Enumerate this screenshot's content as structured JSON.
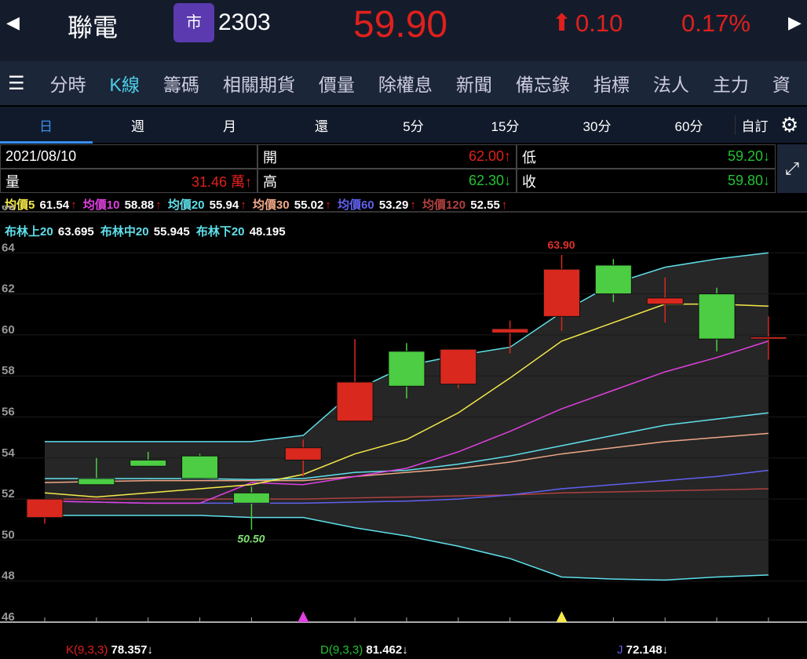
{
  "header": {
    "prev": "◀",
    "next": "▶",
    "name": "聯電",
    "market_badge": "市",
    "code": "2303",
    "price": "59.90",
    "change_arrow": "⬆",
    "change": "0.10",
    "change_pct": "0.17%"
  },
  "tabs": [
    "分時",
    "K線",
    "籌碼",
    "相關期貨",
    "價量",
    "除權息",
    "新聞",
    "備忘錄",
    "指標",
    "法人",
    "主力",
    "資"
  ],
  "periods": [
    "日",
    "週",
    "月",
    "還",
    "5分",
    "15分",
    "30分",
    "60分"
  ],
  "custom": "自訂",
  "info": {
    "date": "2021/08/10",
    "vol_label": "量",
    "vol": "31.46 萬↑",
    "open_label": "開",
    "open": "62.00↑",
    "high_label": "高",
    "high": "62.30↓",
    "low_label": "低",
    "low": "59.20↓",
    "close_label": "收",
    "close": "59.80↓"
  },
  "ma_legend": [
    {
      "label": "均價5",
      "value": "61.54",
      "arrow": "↑",
      "color": "#f5e94a"
    },
    {
      "label": "均價10",
      "value": "58.88",
      "arrow": "↑",
      "color": "#e040e0"
    },
    {
      "label": "均價20",
      "value": "55.94",
      "arrow": "↑",
      "color": "#5fe0ea"
    },
    {
      "label": "均價30",
      "value": "55.02",
      "arrow": "↑",
      "color": "#f0a888"
    },
    {
      "label": "均價60",
      "value": "53.29",
      "arrow": "↑",
      "color": "#6060f0"
    },
    {
      "label": "均價120",
      "value": "52.55",
      "arrow": "↑",
      "color": "#b04040"
    }
  ],
  "boll_legend": [
    {
      "label": "布林上20",
      "value": "63.695"
    },
    {
      "label": "布林中20",
      "value": "55.945"
    },
    {
      "label": "布林下20",
      "value": "48.195"
    }
  ],
  "kdj": {
    "k_label": "K(9,3,3)",
    "k": "78.357↓",
    "d_label": "D(9,3,3)",
    "d": "81.462↓",
    "j_label": "J",
    "j": "72.148↓"
  },
  "chart_data": {
    "type": "candlestick",
    "y_ticks": [
      "66",
      "64",
      "62",
      "60",
      "58",
      "56",
      "54",
      "52",
      "50",
      "48",
      "46"
    ],
    "ylim": [
      46,
      66
    ],
    "candles": [
      {
        "o": 51.1,
        "c": 52.0,
        "h": 52.0,
        "l": 50.8
      },
      {
        "o": 53.0,
        "c": 52.7,
        "h": 54.0,
        "l": 52.7
      },
      {
        "o": 53.9,
        "c": 53.6,
        "h": 54.3,
        "l": 53.6
      },
      {
        "o": 54.1,
        "c": 53.0,
        "h": 54.2,
        "l": 53.0
      },
      {
        "o": 52.3,
        "c": 51.8,
        "h": 52.6,
        "l": 50.5
      },
      {
        "o": 53.9,
        "c": 54.5,
        "h": 54.9,
        "l": 53.1
      },
      {
        "o": 55.8,
        "c": 57.7,
        "h": 59.8,
        "l": 55.8
      },
      {
        "o": 59.2,
        "c": 57.5,
        "h": 59.6,
        "l": 56.9
      },
      {
        "o": 57.6,
        "c": 59.3,
        "h": 59.3,
        "l": 57.4
      },
      {
        "o": 60.1,
        "c": 60.3,
        "h": 60.7,
        "l": 59.1
      },
      {
        "o": 60.9,
        "c": 63.2,
        "h": 63.9,
        "l": 60.2
      },
      {
        "o": 63.4,
        "c": 62.0,
        "h": 63.7,
        "l": 61.6
      },
      {
        "o": 61.5,
        "c": 61.8,
        "h": 62.8,
        "l": 60.6
      },
      {
        "o": 62.0,
        "c": 59.8,
        "h": 62.3,
        "l": 59.2
      },
      {
        "o": 59.8,
        "c": 59.9,
        "h": 60.9,
        "l": 58.8
      }
    ],
    "lines": {
      "ma5": [
        52.3,
        52.1,
        52.3,
        52.5,
        52.7,
        53.2,
        54.2,
        54.9,
        56.2,
        57.9,
        59.7,
        60.6,
        61.5,
        61.5,
        61.4
      ],
      "ma10": [
        51.9,
        51.85,
        51.8,
        51.8,
        52.8,
        52.7,
        53.1,
        53.5,
        54.3,
        55.3,
        56.4,
        57.3,
        58.2,
        58.9,
        59.7
      ],
      "ma20": [
        53.0,
        53.0,
        53.0,
        53.0,
        52.95,
        53.0,
        53.3,
        53.4,
        53.7,
        54.1,
        54.6,
        55.1,
        55.6,
        55.9,
        56.2
      ],
      "ma30": [
        52.8,
        52.85,
        52.9,
        52.9,
        52.9,
        52.9,
        53.1,
        53.3,
        53.5,
        53.8,
        54.2,
        54.5,
        54.8,
        55.0,
        55.2
      ],
      "ma60": [
        51.9,
        51.85,
        51.8,
        51.8,
        51.8,
        51.8,
        51.85,
        51.9,
        52.0,
        52.2,
        52.5,
        52.7,
        52.9,
        53.1,
        53.4
      ],
      "ma120": [
        52.0,
        52.0,
        52.0,
        52.0,
        52.0,
        52.0,
        52.05,
        52.1,
        52.15,
        52.2,
        52.3,
        52.35,
        52.4,
        52.45,
        52.5
      ],
      "boll_up": [
        54.8,
        54.8,
        54.8,
        54.8,
        54.8,
        55.1,
        57.3,
        58.5,
        59.0,
        59.4,
        61.1,
        62.5,
        63.3,
        63.7,
        64.0
      ],
      "boll_low": [
        51.2,
        51.2,
        51.2,
        51.2,
        51.1,
        51.1,
        50.6,
        50.2,
        49.7,
        49.1,
        48.2,
        48.1,
        48.05,
        48.2,
        48.3
      ]
    },
    "annotations": [
      {
        "text": "63.90",
        "candle": 10,
        "value": 63.9
      },
      {
        "text": "50.50",
        "candle": 4,
        "value": 50.5
      }
    ],
    "signals": [
      {
        "candle": 5,
        "color": "#e040e0"
      },
      {
        "candle": 10,
        "color": "#f5e94a"
      }
    ]
  }
}
